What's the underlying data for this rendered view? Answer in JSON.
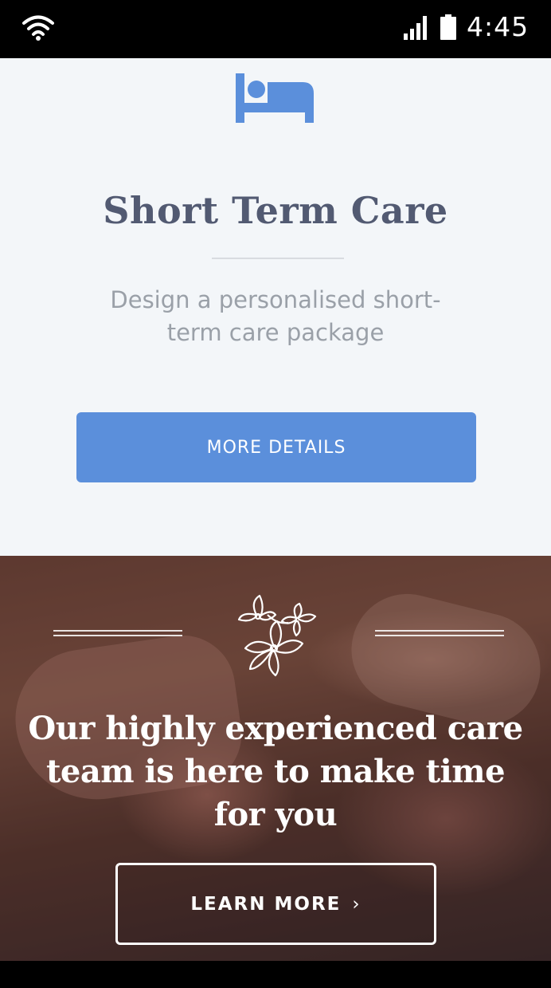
{
  "status_bar": {
    "time": "4:45",
    "icons": [
      "wifi-icon",
      "signal-icon",
      "battery-icon"
    ]
  },
  "card": {
    "icon": "bed-icon",
    "title": "Short Term Care",
    "description": "Design a personalised short-term care package",
    "button_label": "MORE DETAILS"
  },
  "hero": {
    "icon": "flower-icon",
    "headline": "Our highly experienced care team is here to make time for you",
    "button_label": "LEARN MORE",
    "button_icon": "›"
  },
  "colors": {
    "accent": "#5b8fdb",
    "title": "#525a72",
    "card_background": "#f3f6f9",
    "description": "#9aa0a8"
  }
}
